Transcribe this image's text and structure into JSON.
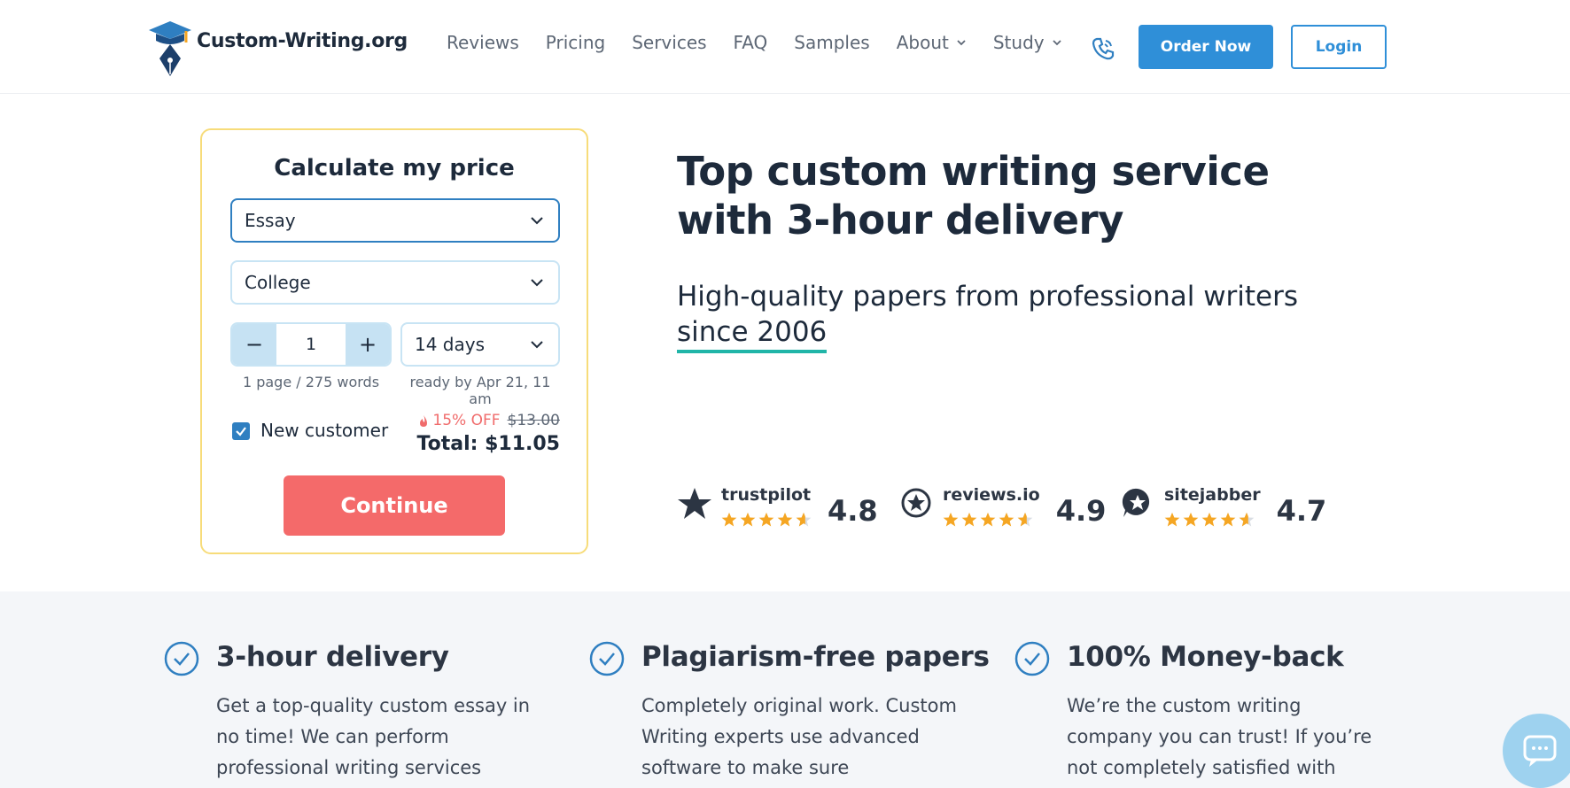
{
  "header": {
    "logo_text": "Custom-Writing.org",
    "nav": [
      {
        "label": "Reviews",
        "dropdown": false
      },
      {
        "label": "Pricing",
        "dropdown": false
      },
      {
        "label": "Services",
        "dropdown": false
      },
      {
        "label": "FAQ",
        "dropdown": false
      },
      {
        "label": "Samples",
        "dropdown": false
      },
      {
        "label": "About",
        "dropdown": true
      },
      {
        "label": "Study",
        "dropdown": true
      }
    ],
    "order_button": "Order Now",
    "login_button": "Login"
  },
  "calculator": {
    "title": "Calculate my price",
    "paper_type": "Essay",
    "academic_level": "College",
    "pages_value": "1",
    "minus": "−",
    "plus": "+",
    "deadline": "14 days",
    "pages_hint": "1 page / 275 words",
    "ready_hint": "ready by Apr 21, 11 am",
    "new_customer_label": "New customer",
    "new_customer_checked": true,
    "discount": "15% OFF",
    "old_price": "$13.00",
    "total": "Total: $11.05",
    "continue_button": "Continue"
  },
  "hero": {
    "title_line1": "Top custom writing service",
    "title_line2": "with 3-hour delivery",
    "subtitle_line1": "High-quality papers from professional writers",
    "subtitle_line2": "since 2006"
  },
  "ratings": [
    {
      "name": "trustpilot",
      "score": "4.8",
      "icon": "trustpilot-star-icon"
    },
    {
      "name": "reviews.io",
      "score": "4.9",
      "icon": "reviews-io-icon"
    },
    {
      "name": "sitejabber",
      "score": "4.7",
      "icon": "sitejabber-icon"
    }
  ],
  "features": [
    {
      "title": "3-hour delivery",
      "text": "Get a top-quality custom essay in no time! We can perform professional writing services"
    },
    {
      "title": "Plagiarism-free papers",
      "text": "Completely original work. Custom Writing experts use advanced software to make sure"
    },
    {
      "title": "100% Money-back",
      "text": "We’re the custom writing company you can trust! If you’re not completely satisfied with"
    }
  ],
  "colors": {
    "accent_blue": "#2f8fd8",
    "continue_red": "#f46a6a",
    "star_orange": "#f5a623",
    "underline_teal": "#21b5a8",
    "calc_border": "#f7dc7a"
  }
}
